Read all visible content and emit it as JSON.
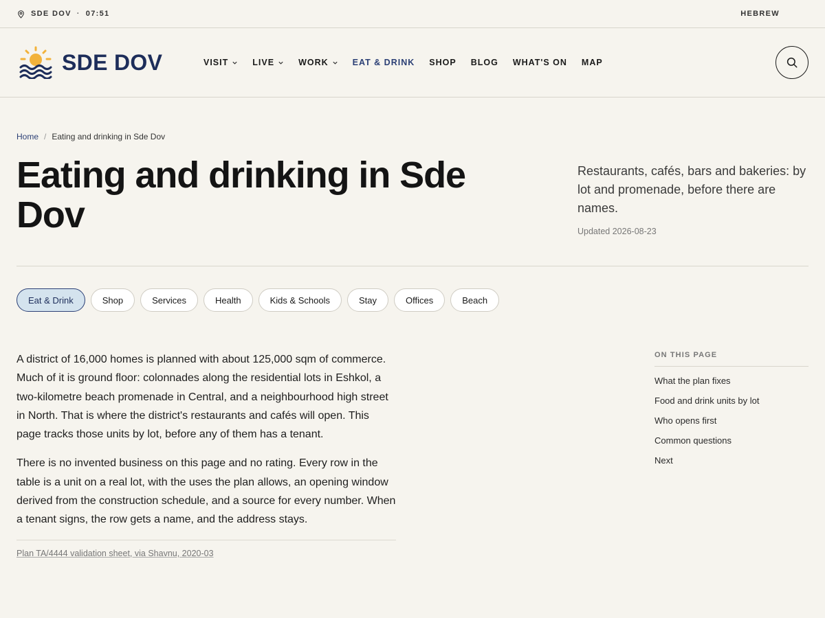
{
  "utility": {
    "location": "SDE DOV",
    "separator": "·",
    "time": "07:51",
    "language": "HEBREW"
  },
  "header": {
    "brand": "SDE DOV",
    "nav": [
      {
        "label": "VISIT",
        "has_menu": true
      },
      {
        "label": "LIVE",
        "has_menu": true
      },
      {
        "label": "WORK",
        "has_menu": true
      },
      {
        "label": "EAT & DRINK",
        "has_menu": false,
        "active": true
      },
      {
        "label": "SHOP",
        "has_menu": false
      },
      {
        "label": "BLOG",
        "has_menu": false
      },
      {
        "label": "WHAT'S ON",
        "has_menu": false
      },
      {
        "label": "MAP",
        "has_menu": false
      }
    ]
  },
  "breadcrumb": {
    "home": "Home",
    "separator": "/",
    "current": "Eating and drinking in Sde Dov"
  },
  "hero": {
    "title": "Eating and drinking in Sde Dov",
    "lede": "Restaurants, cafés, bars and bakeries: by lot and promenade, before there are names.",
    "updated": "Updated 2026-08-23"
  },
  "categories": [
    {
      "label": "Eat & Drink",
      "active": true
    },
    {
      "label": "Shop"
    },
    {
      "label": "Services"
    },
    {
      "label": "Health"
    },
    {
      "label": "Kids & Schools"
    },
    {
      "label": "Stay"
    },
    {
      "label": "Offices"
    },
    {
      "label": "Beach"
    }
  ],
  "article": {
    "paragraphs": [
      "A district of 16,000 homes is planned with about 125,000 sqm of commerce. Much of it is ground floor: colonnades along the residential lots in Eshkol, a two-kilometre beach promenade in Central, and a neighbourhood high street in North. That is where the district's restaurants and cafés will open. This page tracks those units by lot, before any of them has a tenant.",
      "There is no invented business on this page and no rating. Every row in the table is a unit on a real lot, with the uses the plan allows, an opening window derived from the construction schedule, and a source for every number. When a tenant signs, the row gets a name, and the address stays."
    ],
    "source": "Plan TA/4444 validation sheet, via Shavnu, 2020-03"
  },
  "toc": {
    "label": "ON THIS PAGE",
    "items": [
      "What the plan fixes",
      "Food and drink units by lot",
      "Who opens first",
      "Common questions",
      "Next"
    ]
  },
  "colors": {
    "background": "#f6f4ee",
    "brand_navy": "#1d2d5a",
    "sun": "#f2b23a",
    "active_pill": "#d4e3ee"
  },
  "icons": {
    "location": "map-pin-icon",
    "logo": "sun-waves-logo",
    "search": "search-icon",
    "chevron": "chevron-down-icon"
  }
}
